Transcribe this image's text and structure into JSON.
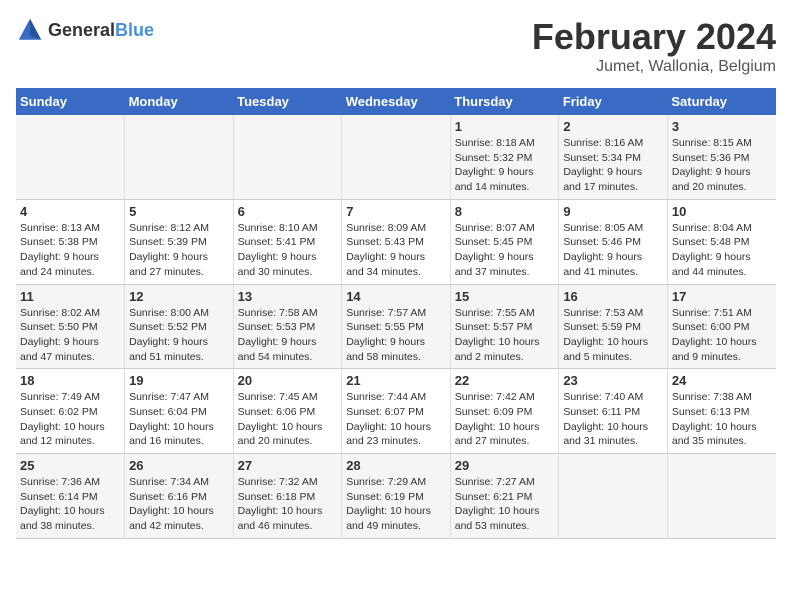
{
  "logo": {
    "text_general": "General",
    "text_blue": "Blue"
  },
  "title": "February 2024",
  "subtitle": "Jumet, Wallonia, Belgium",
  "days_of_week": [
    "Sunday",
    "Monday",
    "Tuesday",
    "Wednesday",
    "Thursday",
    "Friday",
    "Saturday"
  ],
  "weeks": [
    [
      {
        "day": "",
        "info": ""
      },
      {
        "day": "",
        "info": ""
      },
      {
        "day": "",
        "info": ""
      },
      {
        "day": "",
        "info": ""
      },
      {
        "day": "1",
        "info": "Sunrise: 8:18 AM\nSunset: 5:32 PM\nDaylight: 9 hours\nand 14 minutes."
      },
      {
        "day": "2",
        "info": "Sunrise: 8:16 AM\nSunset: 5:34 PM\nDaylight: 9 hours\nand 17 minutes."
      },
      {
        "day": "3",
        "info": "Sunrise: 8:15 AM\nSunset: 5:36 PM\nDaylight: 9 hours\nand 20 minutes."
      }
    ],
    [
      {
        "day": "4",
        "info": "Sunrise: 8:13 AM\nSunset: 5:38 PM\nDaylight: 9 hours\nand 24 minutes."
      },
      {
        "day": "5",
        "info": "Sunrise: 8:12 AM\nSunset: 5:39 PM\nDaylight: 9 hours\nand 27 minutes."
      },
      {
        "day": "6",
        "info": "Sunrise: 8:10 AM\nSunset: 5:41 PM\nDaylight: 9 hours\nand 30 minutes."
      },
      {
        "day": "7",
        "info": "Sunrise: 8:09 AM\nSunset: 5:43 PM\nDaylight: 9 hours\nand 34 minutes."
      },
      {
        "day": "8",
        "info": "Sunrise: 8:07 AM\nSunset: 5:45 PM\nDaylight: 9 hours\nand 37 minutes."
      },
      {
        "day": "9",
        "info": "Sunrise: 8:05 AM\nSunset: 5:46 PM\nDaylight: 9 hours\nand 41 minutes."
      },
      {
        "day": "10",
        "info": "Sunrise: 8:04 AM\nSunset: 5:48 PM\nDaylight: 9 hours\nand 44 minutes."
      }
    ],
    [
      {
        "day": "11",
        "info": "Sunrise: 8:02 AM\nSunset: 5:50 PM\nDaylight: 9 hours\nand 47 minutes."
      },
      {
        "day": "12",
        "info": "Sunrise: 8:00 AM\nSunset: 5:52 PM\nDaylight: 9 hours\nand 51 minutes."
      },
      {
        "day": "13",
        "info": "Sunrise: 7:58 AM\nSunset: 5:53 PM\nDaylight: 9 hours\nand 54 minutes."
      },
      {
        "day": "14",
        "info": "Sunrise: 7:57 AM\nSunset: 5:55 PM\nDaylight: 9 hours\nand 58 minutes."
      },
      {
        "day": "15",
        "info": "Sunrise: 7:55 AM\nSunset: 5:57 PM\nDaylight: 10 hours\nand 2 minutes."
      },
      {
        "day": "16",
        "info": "Sunrise: 7:53 AM\nSunset: 5:59 PM\nDaylight: 10 hours\nand 5 minutes."
      },
      {
        "day": "17",
        "info": "Sunrise: 7:51 AM\nSunset: 6:00 PM\nDaylight: 10 hours\nand 9 minutes."
      }
    ],
    [
      {
        "day": "18",
        "info": "Sunrise: 7:49 AM\nSunset: 6:02 PM\nDaylight: 10 hours\nand 12 minutes."
      },
      {
        "day": "19",
        "info": "Sunrise: 7:47 AM\nSunset: 6:04 PM\nDaylight: 10 hours\nand 16 minutes."
      },
      {
        "day": "20",
        "info": "Sunrise: 7:45 AM\nSunset: 6:06 PM\nDaylight: 10 hours\nand 20 minutes."
      },
      {
        "day": "21",
        "info": "Sunrise: 7:44 AM\nSunset: 6:07 PM\nDaylight: 10 hours\nand 23 minutes."
      },
      {
        "day": "22",
        "info": "Sunrise: 7:42 AM\nSunset: 6:09 PM\nDaylight: 10 hours\nand 27 minutes."
      },
      {
        "day": "23",
        "info": "Sunrise: 7:40 AM\nSunset: 6:11 PM\nDaylight: 10 hours\nand 31 minutes."
      },
      {
        "day": "24",
        "info": "Sunrise: 7:38 AM\nSunset: 6:13 PM\nDaylight: 10 hours\nand 35 minutes."
      }
    ],
    [
      {
        "day": "25",
        "info": "Sunrise: 7:36 AM\nSunset: 6:14 PM\nDaylight: 10 hours\nand 38 minutes."
      },
      {
        "day": "26",
        "info": "Sunrise: 7:34 AM\nSunset: 6:16 PM\nDaylight: 10 hours\nand 42 minutes."
      },
      {
        "day": "27",
        "info": "Sunrise: 7:32 AM\nSunset: 6:18 PM\nDaylight: 10 hours\nand 46 minutes."
      },
      {
        "day": "28",
        "info": "Sunrise: 7:29 AM\nSunset: 6:19 PM\nDaylight: 10 hours\nand 49 minutes."
      },
      {
        "day": "29",
        "info": "Sunrise: 7:27 AM\nSunset: 6:21 PM\nDaylight: 10 hours\nand 53 minutes."
      },
      {
        "day": "",
        "info": ""
      },
      {
        "day": "",
        "info": ""
      }
    ]
  ]
}
